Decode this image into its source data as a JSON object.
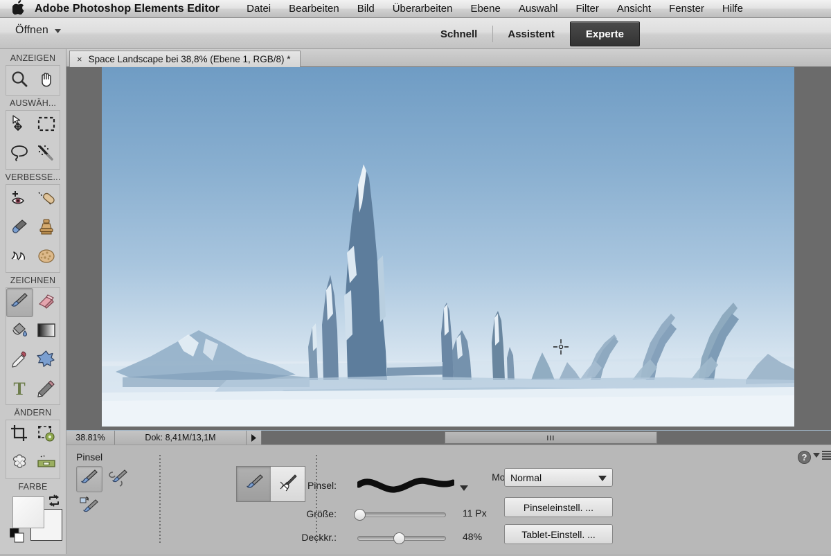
{
  "menubar": {
    "apple_icon": "apple-logo-icon",
    "app_title": "Adobe Photoshop Elements Editor",
    "items": [
      {
        "label": "Datei"
      },
      {
        "label": "Bearbeiten"
      },
      {
        "label": "Bild"
      },
      {
        "label": "Überarbeiten"
      },
      {
        "label": "Ebene"
      },
      {
        "label": "Auswahl"
      },
      {
        "label": "Filter"
      },
      {
        "label": "Ansicht"
      },
      {
        "label": "Fenster"
      },
      {
        "label": "Hilfe"
      }
    ]
  },
  "modebar": {
    "open_label": "Öffnen",
    "tabs": [
      {
        "label": "Schnell",
        "active": false
      },
      {
        "label": "Assistent",
        "active": false
      },
      {
        "label": "Experte",
        "active": true
      }
    ]
  },
  "document_tab": {
    "close_glyph": "×",
    "title": "Space Landscape bei 38,8% (Ebene 1, RGB/8) *"
  },
  "toolbar": {
    "sections": [
      {
        "label": "ANZEIGEN",
        "tools": [
          {
            "name": "zoom-tool",
            "icon": "magnifier-icon",
            "selected": false
          },
          {
            "name": "hand-tool",
            "icon": "hand-icon",
            "selected": false
          }
        ]
      },
      {
        "label": "AUSWÄH...",
        "tools": [
          {
            "name": "move-tool",
            "icon": "move-arrow-icon",
            "selected": false
          },
          {
            "name": "marquee-tool",
            "icon": "rectangular-marquee-icon",
            "selected": false
          },
          {
            "name": "lasso-tool",
            "icon": "lasso-icon",
            "selected": false
          },
          {
            "name": "magic-wand-tool",
            "icon": "magic-wand-icon",
            "selected": false
          }
        ]
      },
      {
        "label": "VERBESSE...",
        "tools": [
          {
            "name": "red-eye-tool",
            "icon": "red-eye-icon",
            "selected": false
          },
          {
            "name": "spot-healing-tool",
            "icon": "bandage-icon",
            "selected": false
          },
          {
            "name": "smart-brush-tool",
            "icon": "smart-brush-icon",
            "selected": false
          },
          {
            "name": "clone-stamp-tool",
            "icon": "stamp-icon",
            "selected": false
          },
          {
            "name": "blur-tool",
            "icon": "blur-icon",
            "selected": false
          },
          {
            "name": "sponge-tool",
            "icon": "sponge-icon",
            "selected": false
          }
        ]
      },
      {
        "label": "ZEICHNEN",
        "tools": [
          {
            "name": "brush-tool",
            "icon": "paintbrush-icon",
            "selected": true
          },
          {
            "name": "eraser-tool",
            "icon": "eraser-icon",
            "selected": false
          },
          {
            "name": "paint-bucket-tool",
            "icon": "paint-bucket-icon",
            "selected": false
          },
          {
            "name": "gradient-tool",
            "icon": "gradient-icon",
            "selected": false
          },
          {
            "name": "color-picker-tool",
            "icon": "eyedropper-icon",
            "selected": false
          },
          {
            "name": "custom-shape-tool",
            "icon": "blob-shape-icon",
            "selected": false
          },
          {
            "name": "type-tool",
            "icon": "text-t-icon",
            "selected": false
          },
          {
            "name": "pencil-tool",
            "icon": "pencil-icon",
            "selected": false
          }
        ]
      },
      {
        "label": "ÄNDERN",
        "tools": [
          {
            "name": "crop-tool",
            "icon": "crop-icon",
            "selected": false
          },
          {
            "name": "recompose-tool",
            "icon": "recompose-icon",
            "selected": false
          },
          {
            "name": "cookie-cutter-tool",
            "icon": "cookie-cutter-flower-icon",
            "selected": false
          },
          {
            "name": "straighten-tool",
            "icon": "straighten-level-icon",
            "selected": false
          }
        ]
      }
    ],
    "color_label": "FARBE",
    "swap_icon": "swap-colors-icon",
    "default_colors_icon": "default-colors-icon"
  },
  "statusbar": {
    "zoom_level": "38.81%",
    "doc_size": "Dok: 8,41M/13,1M",
    "arrow_glyph": "▶"
  },
  "options_panel": {
    "title": "Pinsel",
    "help_icon": "help-question-icon",
    "menu_icon": "panel-menu-icon",
    "brush_variants": [
      {
        "name": "brush-variant-basic",
        "icon": "paintbrush-icon",
        "selected": true
      },
      {
        "name": "brush-variant-impressionist",
        "icon": "impressionist-brush-icon",
        "selected": false
      },
      {
        "name": "brush-variant-replace-color",
        "icon": "color-replacement-brush-icon",
        "selected": false
      }
    ],
    "mode_toggle": [
      {
        "name": "toggle-brush",
        "icon": "paintbrush-icon",
        "on": true
      },
      {
        "name": "toggle-airbrush",
        "icon": "airbrush-icon",
        "on": false
      }
    ],
    "brush_label": "Pinsel:",
    "brush_preview": "wavy-stroke-preview",
    "size_label": "Größe:",
    "size_value": "11 Px",
    "size_percent": 4,
    "opacity_label": "Deckkr.:",
    "opacity_value": "48%",
    "opacity_percent": 48,
    "modus_label": "Modus:",
    "modus_value": "Normal",
    "brush_settings_button": "Pinseleinstell. ...",
    "tablet_settings_button": "Tablet-Einstell. ..."
  },
  "canvas": {
    "artwork_title": "Space Landscape",
    "cursor_icon": "crosshair-cursor",
    "sky_top_color": "#6f9cc4",
    "sky_bottom_color": "#eaf1f7",
    "ice_dark_color": "#5e7f9c",
    "ice_light_color": "#e8f0f6",
    "surround_color": "#6b6b6b"
  },
  "colors": {
    "accent_active_tab": "#3a3a3a",
    "panel_bg": "#b8b8b8",
    "toolbar_bg": "#c9c9c9"
  }
}
